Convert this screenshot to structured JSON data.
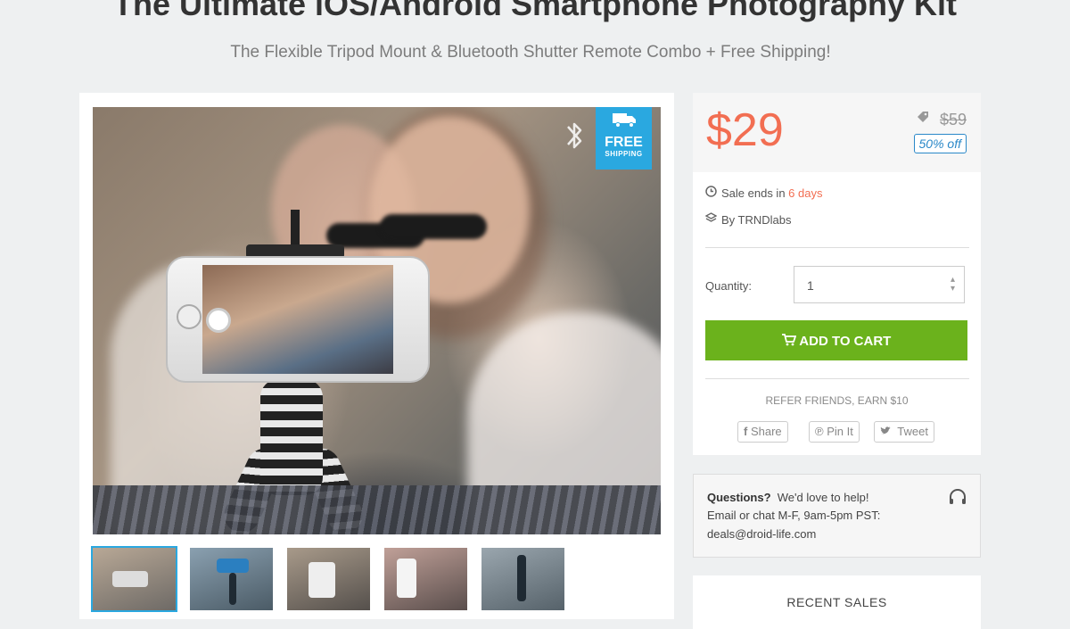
{
  "product": {
    "title": "The Ultimate iOS/Android Smartphone Photography Kit",
    "subtitle": "The Flexible Tripod Mount & Bluetooth Shutter Remote Combo + Free Shipping!"
  },
  "badge": {
    "free": "FREE",
    "shipping": "SHIPPING",
    "icon": "truck-icon",
    "color": "#2aa8e0"
  },
  "pricing": {
    "price": "$29",
    "old_price": "$59",
    "discount": "50% off",
    "price_color": "#f26e52"
  },
  "meta": {
    "sale_prefix": "Sale ends in ",
    "sale_days": "6 days",
    "by": "By TRNDlabs"
  },
  "quantity": {
    "label": "Quantity:",
    "value": "1"
  },
  "cart": {
    "label": "ADD TO CART",
    "icon": "cart-icon",
    "color": "#6bb21c"
  },
  "share": {
    "refer": "REFER FRIENDS, EARN $10",
    "buttons": [
      "Share",
      "Pin It",
      "Tweet"
    ],
    "icons": [
      "facebook-icon",
      "pinterest-icon",
      "twitter-icon"
    ]
  },
  "help": {
    "heading": "Questions?",
    "line1": "We'd love to help!",
    "line2": "Email or chat M-F, 9am-5pm PST:",
    "email": "deals@droid-life.com"
  },
  "recent": {
    "title": "RECENT SALES"
  }
}
